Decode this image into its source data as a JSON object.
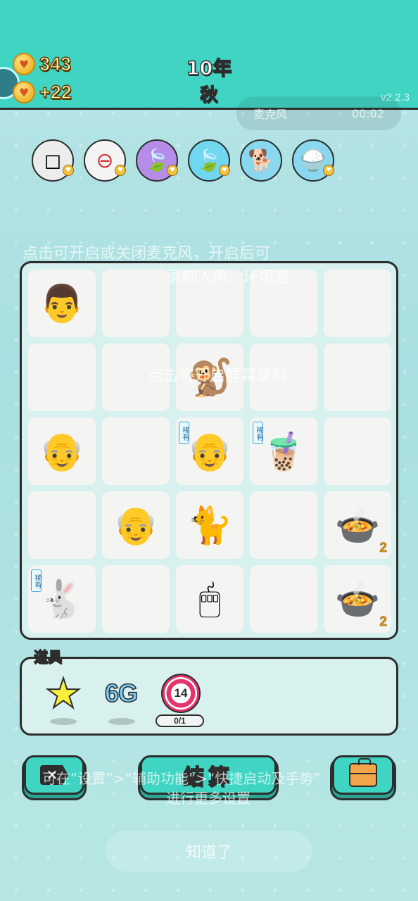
{
  "header": {
    "coins": "343",
    "income": "+22",
    "year": "10年",
    "season": "秋",
    "version": "v2.2.3"
  },
  "mic_overlay": {
    "label": "麦克风",
    "timer": "00:02"
  },
  "effects": [
    {
      "icon": "sugar-cubes-icon",
      "bg": "#ececec"
    },
    {
      "icon": "minus-sign-icon",
      "bg": "#f4f4f4"
    },
    {
      "icon": "leaf-icon",
      "bg": "#b58de8"
    },
    {
      "icon": "leaf-icon",
      "bg": "#6fd8f0"
    },
    {
      "icon": "dog-icon",
      "bg": "#8ad7f0"
    },
    {
      "icon": "rice-bowl-icon",
      "bg": "#8ad7f0"
    }
  ],
  "overlay_hints": {
    "mic_hint_line1": "点击可开启或关闭麦克风，开启后可",
    "mic_hint_line2": "录制人声、环境音",
    "screen_record_hint": "点击可开启屏幕录制",
    "settings_hint_line1": "可在“设置”>“辅助功能”>“快捷启动及手势”",
    "settings_hint_line2": "进行更多设置",
    "know_button": "知道了"
  },
  "board": {
    "rare_label": "稀有",
    "cells": [
      {
        "symbol": "👨",
        "name": "man-face"
      },
      {
        "symbol": ""
      },
      {
        "symbol": ""
      },
      {
        "symbol": ""
      },
      {
        "symbol": ""
      },
      {
        "symbol": ""
      },
      {
        "symbol": ""
      },
      {
        "symbol": "🐒",
        "name": "monkey"
      },
      {
        "symbol": ""
      },
      {
        "symbol": ""
      },
      {
        "symbol": "👴",
        "name": "grandpa-glasses"
      },
      {
        "symbol": ""
      },
      {
        "symbol": "👴",
        "name": "grandpa",
        "rare": true
      },
      {
        "symbol": "🧋",
        "name": "bubble-tea",
        "rare": true
      },
      {
        "symbol": ""
      },
      {
        "symbol": ""
      },
      {
        "symbol": "👴",
        "name": "grandpa-glasses"
      },
      {
        "symbol": "🐈",
        "name": "cat"
      },
      {
        "symbol": ""
      },
      {
        "symbol": "🍲",
        "name": "soup-bowl",
        "count": "2"
      },
      {
        "symbol": "🐇",
        "name": "rabbit",
        "rare": true
      },
      {
        "symbol": ""
      },
      {
        "symbol": "🖱",
        "name": "computer-mouse"
      },
      {
        "symbol": ""
      },
      {
        "symbol": "🍲",
        "name": "soup-bowl",
        "count": "2"
      }
    ]
  },
  "tools": {
    "title": "道具",
    "sixg_label": "6G",
    "target_count": "14",
    "target_progress": "0/1"
  },
  "buttons": {
    "exit_label": "✕",
    "settle_label": "结算"
  }
}
